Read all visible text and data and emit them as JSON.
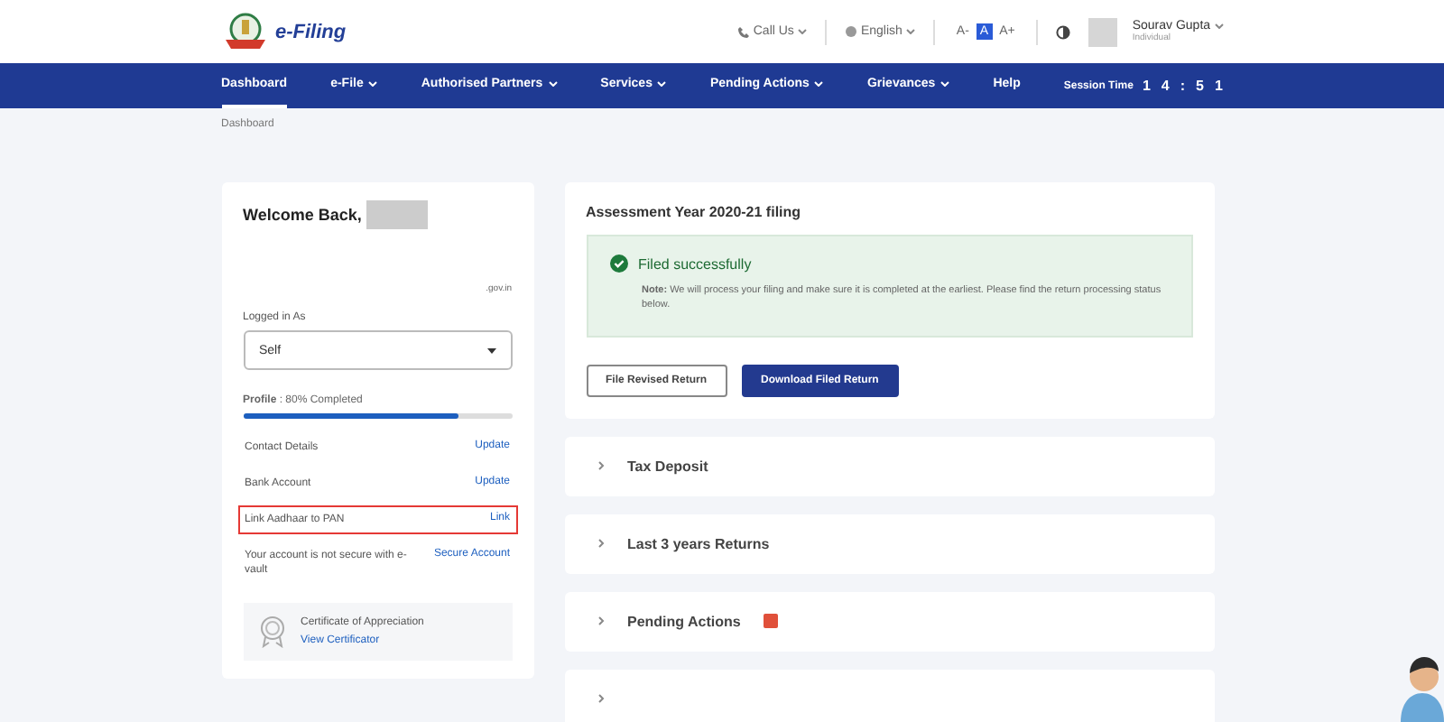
{
  "header": {
    "logo_text": "e-Filing",
    "call_us": "Call Us",
    "language": "English",
    "text_sizes": [
      "A-",
      "A",
      "A+"
    ],
    "user": {
      "name": "Sourav Gupta",
      "role": "Individual"
    }
  },
  "nav": {
    "items": [
      {
        "label": "Dashboard",
        "selected": true,
        "dropdown": false
      },
      {
        "label": "e-File",
        "selected": false,
        "dropdown": true
      },
      {
        "label": "Authorised Partners",
        "selected": false,
        "dropdown": true
      },
      {
        "label": "Services",
        "selected": false,
        "dropdown": true
      },
      {
        "label": "Pending Actions",
        "selected": false,
        "dropdown": true
      },
      {
        "label": "Grievances",
        "selected": false,
        "dropdown": true
      },
      {
        "label": "Help",
        "selected": false,
        "dropdown": false
      }
    ],
    "session_label": "Session Time",
    "session_digits": [
      "1",
      "4",
      ":",
      "5",
      "1"
    ]
  },
  "breadcrumb": "Dashboard",
  "profile_card": {
    "welcome": "Welcome Back,",
    "email_suffix": ".gov.in",
    "logged_in_label": "Logged in As",
    "logged_in_value": "Self",
    "profile_label": "Profile",
    "profile_status": ": 80% Completed",
    "level": 0.8,
    "rows": [
      {
        "label": "Contact Details",
        "action": "Update",
        "highlighted": false
      },
      {
        "label": "Bank Account",
        "action": "Update",
        "highlighted": false
      },
      {
        "label": "Link Aadhaar to PAN",
        "action": "Link",
        "highlighted": true
      },
      {
        "label": "Your account is not secure with e-vault",
        "action": "Secure Account",
        "highlighted": false
      }
    ],
    "certificate": {
      "title": "Certificate of Appreciation",
      "link": "View Certificator"
    }
  },
  "filing_card": {
    "title": "Assessment Year 2020-21 filing",
    "status": "Filed successfully",
    "note_label": "Note:",
    "note": "We will process your filing and make sure it is completed at the earliest. Please find the return processing status below.",
    "buttons": [
      {
        "label": "File Revised Return",
        "kind": "outline"
      },
      {
        "label": "Download Filed Return",
        "kind": "primary"
      }
    ]
  },
  "accordions": [
    {
      "label": "Tax Deposit",
      "badge": false
    },
    {
      "label": "Last 3 years Returns",
      "badge": false
    },
    {
      "label": "Pending Actions",
      "badge": true
    },
    {
      "badge": false
    }
  ]
}
